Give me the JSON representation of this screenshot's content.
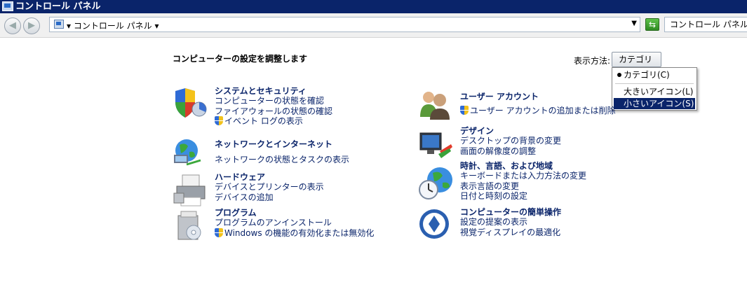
{
  "window": {
    "title": "コントロール パネル"
  },
  "address": {
    "crumb": "▾ コントロール パネル ▾",
    "dropdown": "▼",
    "search_placeholder": "コントロール パネルの検"
  },
  "nav": {
    "back": "◀",
    "forward": "▶",
    "refresh": "⇆"
  },
  "heading": "コンピューターの設定を調整します",
  "view": {
    "label": "表示方法:",
    "button": "カテゴリ ▼",
    "options": [
      "カテゴリ(C)",
      "大きいアイコン(L)",
      "小さいアイコン(S)"
    ],
    "selected_index": 0,
    "highlighted_index": 2
  },
  "categories": [
    {
      "title": "システムとセキュリティ",
      "icon": "security-shield-icon",
      "links": [
        {
          "text": "コンピューターの状態を確認",
          "shield": false
        },
        {
          "text": "ファイアウォールの状態の確認",
          "shield": false
        },
        {
          "text": "イベント ログの表示",
          "shield": true
        }
      ]
    },
    {
      "title": "ネットワークとインターネット",
      "icon": "network-globe-icon",
      "links": [
        {
          "text": "ネットワークの状態とタスクの表示",
          "shield": false
        }
      ]
    },
    {
      "title": "ハードウェア",
      "icon": "printer-icon",
      "links": [
        {
          "text": "デバイスとプリンターの表示",
          "shield": false
        },
        {
          "text": "デバイスの追加",
          "shield": false
        }
      ]
    },
    {
      "title": "プログラム",
      "icon": "programs-box-icon",
      "links": [
        {
          "text": "プログラムのアンインストール",
          "shield": false
        },
        {
          "text": "Windows の機能の有効化または無効化",
          "shield": true
        }
      ]
    },
    {
      "title": "ユーザー アカウント",
      "icon": "user-accounts-icon",
      "links": [
        {
          "text": "ユーザー アカウントの追加または削除",
          "shield": true
        }
      ]
    },
    {
      "title": "デザイン",
      "icon": "appearance-icon",
      "links": [
        {
          "text": "デスクトップの背景の変更",
          "shield": false
        },
        {
          "text": "画面の解像度の調整",
          "shield": false
        }
      ]
    },
    {
      "title": "時計、言語、および地域",
      "icon": "clock-globe-icon",
      "links": [
        {
          "text": "キーボードまたは入力方法の変更",
          "shield": false
        },
        {
          "text": "表示言語の変更",
          "shield": false
        },
        {
          "text": "日付と時刻の設定",
          "shield": false
        }
      ]
    },
    {
      "title": "コンピューターの簡単操作",
      "icon": "ease-of-access-icon",
      "links": [
        {
          "text": "設定の提案の表示",
          "shield": false
        },
        {
          "text": "視覚ディスプレイの最適化",
          "shield": false
        }
      ]
    }
  ]
}
